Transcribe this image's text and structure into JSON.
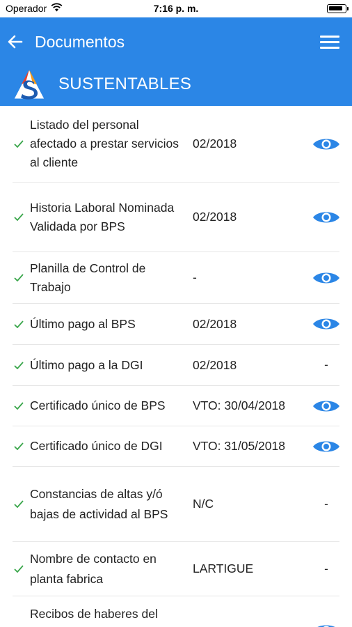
{
  "status": {
    "carrier": "Operador",
    "time": "7:16 p. m."
  },
  "header": {
    "title": "Documentos",
    "brand": "SUSTENTABLES",
    "colors": {
      "primary": "#2b86e6",
      "check": "#3aa64b",
      "eye": "#2b86e6"
    }
  },
  "documents": [
    {
      "label": "Listado del personal afectado a prestar servicios al cliente",
      "value": "02/2018",
      "action": "eye-icon"
    },
    {
      "label": "Historia Laboral Nominada Validada por BPS",
      "value": "02/2018",
      "action": "eye-icon"
    },
    {
      "label": "Planilla de Control de Trabajo",
      "value": "-",
      "action": "eye-icon"
    },
    {
      "label": "Último pago al BPS",
      "value": "02/2018",
      "action": "eye-icon"
    },
    {
      "label": "Último pago a la DGI",
      "value": "02/2018",
      "action": "-"
    },
    {
      "label": "Certificado único de BPS",
      "value": "VTO: 30/04/2018",
      "action": "eye-icon"
    },
    {
      "label": "Certificado único de DGI",
      "value": "VTO: 31/05/2018",
      "action": "eye-icon"
    },
    {
      "label": "Constancias de altas y/ó bajas de actividad al BPS",
      "value": "N/C",
      "action": "-"
    },
    {
      "label": "Nombre de contacto en planta fabrica",
      "value": "LARTIGUE",
      "action": "-"
    },
    {
      "label": "Recibos de haberes del",
      "value": "",
      "action": "eye-icon"
    }
  ]
}
